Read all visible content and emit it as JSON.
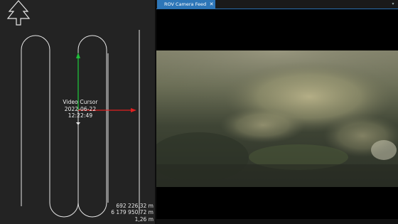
{
  "map": {
    "north_arrow_icon": "north-arrow-icon",
    "video_cursor": {
      "title": "Video Cursor",
      "date": "2022-06-22",
      "time": "12:22:49"
    },
    "readout": {
      "easting": "692 226,32 m",
      "northing": "6 179 950,72 m",
      "depth": "1,26 m"
    },
    "colors": {
      "background": "#232323",
      "track": "#e6e6e6",
      "axis_north": "#1fbf3a",
      "axis_east": "#e02020"
    }
  },
  "camera": {
    "tab_label": "ROV Camera Feed",
    "close_icon": "close-icon",
    "menu_icon": "menu-icon",
    "accent": "#2d76b8"
  }
}
